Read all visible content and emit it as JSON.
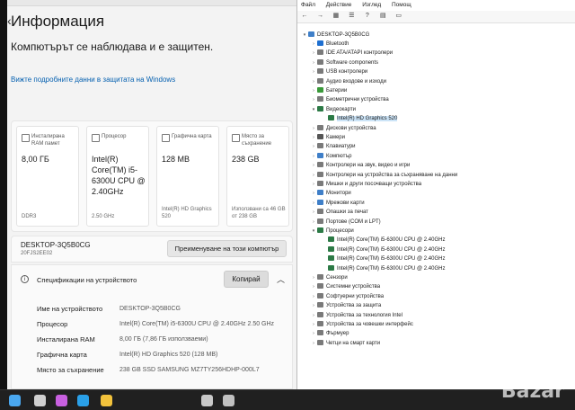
{
  "settings": {
    "title": "Информация",
    "protect_text": "Компютърът се наблюдава и е защитен.",
    "more_link": "Вижте подробните данни в защитата на Windows",
    "cards": [
      {
        "label": "Инсталирана RAM памет",
        "value": "8,00 ГБ",
        "sub": "DDR3"
      },
      {
        "label": "Процесор",
        "value": "Intel(R) Core(TM) i5-6300U CPU @ 2.40GHz",
        "sub": "2.50 GHz"
      },
      {
        "label": "Графична карта",
        "value": "128 MB",
        "sub": "Intel(R) HD Graphics 520"
      },
      {
        "label": "Място за съхранение",
        "value": "238 GB",
        "sub": "Използвани са 46 GB от 238 GB"
      }
    ],
    "device_name": "DESKTOP-3Q5B0CG",
    "device_sub": "20FJS2EE02",
    "rename_button": "Преименуване на този компютър",
    "spec_title": "Спецификации на устройството",
    "copy_button": "Копирай",
    "specs": [
      {
        "key": "Име на устройството",
        "value": "DESKTOP-3Q5B0CG"
      },
      {
        "key": "Процесор",
        "value": "Intel(R) Core(TM) i5-6300U CPU @ 2.40GHz 2.50 GHz"
      },
      {
        "key": "Инсталирана RAM памет",
        "value": "8,00 ГБ (7,86 ГБ използваеми)"
      },
      {
        "key": "Графична карта",
        "value": "Intel(R) HD Graphics 520 (128 MB)"
      },
      {
        "key": "Място за съхранение",
        "value": "238 GB SSD SAMSUNG MZ7TY256HDHP-000L7"
      }
    ]
  },
  "device_manager": {
    "menu": [
      "Файл",
      "Действие",
      "Изглед",
      "Помощ"
    ],
    "root": "DESKTOP-3Q5B0CG",
    "nodes": [
      {
        "label": "Bluetooth",
        "level": 1,
        "expanded": false,
        "color": "#1e6fd0"
      },
      {
        "label": "IDE ATA/ATAPI контролери",
        "level": 1,
        "expanded": false,
        "color": "#7a7a7a"
      },
      {
        "label": "Software components",
        "level": 1,
        "expanded": false,
        "color": "#7a7a7a"
      },
      {
        "label": "USB контролери",
        "level": 1,
        "expanded": false,
        "color": "#7a7a7a"
      },
      {
        "label": "Аудио входове и изходи",
        "level": 1,
        "expanded": false,
        "color": "#7a7a7a"
      },
      {
        "label": "Батерии",
        "level": 1,
        "expanded": false,
        "color": "#3a9a3a"
      },
      {
        "label": "Биометрични устройства",
        "level": 1,
        "expanded": false,
        "color": "#7a7a7a"
      },
      {
        "label": "Видеокарти",
        "level": 1,
        "expanded": true,
        "color": "#2c7a46"
      },
      {
        "label": "Intel(R) HD Graphics 520",
        "level": 2,
        "expanded": null,
        "color": "#2c7a46",
        "selected": true
      },
      {
        "label": "Дискови устройства",
        "level": 1,
        "expanded": false,
        "color": "#7a7a7a"
      },
      {
        "label": "Камери",
        "level": 1,
        "expanded": false,
        "color": "#555555"
      },
      {
        "label": "Клавиатури",
        "level": 1,
        "expanded": false,
        "color": "#7a7a7a"
      },
      {
        "label": "Компютър",
        "level": 1,
        "expanded": false,
        "color": "#3f7fc8"
      },
      {
        "label": "Контролери на звук, видео и игри",
        "level": 1,
        "expanded": false,
        "color": "#7a7a7a"
      },
      {
        "label": "Контролери на устройства за съхраняване на данни",
        "level": 1,
        "expanded": false,
        "color": "#7a7a7a"
      },
      {
        "label": "Мишки и други посочващи устройства",
        "level": 1,
        "expanded": false,
        "color": "#7a7a7a"
      },
      {
        "label": "Монитори",
        "level": 1,
        "expanded": false,
        "color": "#3f7fc8"
      },
      {
        "label": "Мрежови карти",
        "level": 1,
        "expanded": false,
        "color": "#3f7fc8"
      },
      {
        "label": "Опашки за печат",
        "level": 1,
        "expanded": false,
        "color": "#7a7a7a"
      },
      {
        "label": "Портове (COM и LPT)",
        "level": 1,
        "expanded": false,
        "color": "#7a7a7a"
      },
      {
        "label": "Процесори",
        "level": 1,
        "expanded": true,
        "color": "#2c7a46"
      },
      {
        "label": "Intel(R) Core(TM) i5-6300U CPU @ 2.40GHz",
        "level": 2,
        "expanded": null,
        "color": "#2c7a46"
      },
      {
        "label": "Intel(R) Core(TM) i5-6300U CPU @ 2.40GHz",
        "level": 2,
        "expanded": null,
        "color": "#2c7a46"
      },
      {
        "label": "Intel(R) Core(TM) i5-6300U CPU @ 2.40GHz",
        "level": 2,
        "expanded": null,
        "color": "#2c7a46"
      },
      {
        "label": "Intel(R) Core(TM) i5-6300U CPU @ 2.40GHz",
        "level": 2,
        "expanded": null,
        "color": "#2c7a46"
      },
      {
        "label": "Сензори",
        "level": 1,
        "expanded": false,
        "color": "#7a7a7a"
      },
      {
        "label": "Системни устройства",
        "level": 1,
        "expanded": false,
        "color": "#7a7a7a"
      },
      {
        "label": "Софтуерни устройства",
        "level": 1,
        "expanded": false,
        "color": "#7a7a7a"
      },
      {
        "label": "Устройства за защита",
        "level": 1,
        "expanded": false,
        "color": "#7a7a7a"
      },
      {
        "label": "Устройства за технология Intel",
        "level": 1,
        "expanded": false,
        "color": "#7a7a7a"
      },
      {
        "label": "Устройства за човешки интерфейс",
        "level": 1,
        "expanded": false,
        "color": "#7a7a7a"
      },
      {
        "label": "Фърмуер",
        "level": 1,
        "expanded": false,
        "color": "#7a7a7a"
      },
      {
        "label": "Четци на смарт карти",
        "level": 1,
        "expanded": false,
        "color": "#7a7a7a"
      }
    ]
  },
  "taskbar": {
    "icons": [
      "windows-start",
      "search",
      "copilot",
      "edge",
      "file-explorer",
      "gear",
      "device-manager"
    ],
    "colors": [
      "#4aa8f0",
      "#d0d0d0",
      "#c860e0",
      "#2aa0e8",
      "#f2c23c",
      "#c8c8c8",
      "#c0c0c0"
    ]
  },
  "watermark": "Bazar"
}
